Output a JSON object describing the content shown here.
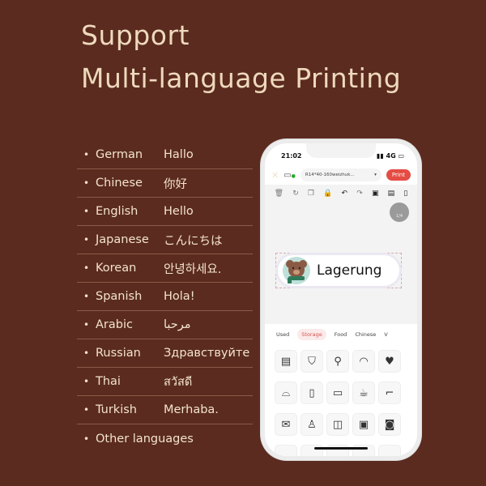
{
  "heading": {
    "line1": "Support",
    "line2": "Multi-language Printing"
  },
  "languages": [
    {
      "name": "German",
      "sample": "Hallo"
    },
    {
      "name": "Chinese",
      "sample": "你好"
    },
    {
      "name": "English",
      "sample": "Hello"
    },
    {
      "name": "Japanese",
      "sample": "こんにちは"
    },
    {
      "name": "Korean",
      "sample": "안녕하세요."
    },
    {
      "name": "Spanish",
      "sample": "Hola!"
    },
    {
      "name": "Arabic",
      "sample": "مرحبا"
    },
    {
      "name": "Russian",
      "sample": "Здравствуйте"
    },
    {
      "name": "Thai",
      "sample": "สวัสดี"
    },
    {
      "name": "Turkish",
      "sample": "Merhaba."
    },
    {
      "name": "Other languages",
      "sample": ""
    }
  ],
  "phone": {
    "time": "21:02",
    "signal": "4G",
    "template": "R14*40-160weizhuk...",
    "print_label": "Print",
    "page_indicator": "1/4",
    "label_text": "Lagerung",
    "tabs": [
      "Used",
      "Storage",
      "Food",
      "Chinese",
      "V"
    ],
    "active_tab": "Storage",
    "accent": "#e44c44",
    "icons": [
      "box",
      "backpack",
      "desk-lamp",
      "cap",
      "t-shirt",
      "hat",
      "fridge",
      "toilet-paper",
      "toothbrush-cup",
      "boot",
      "bag",
      "dress",
      "wardrobe",
      "microwave",
      "washing-machine"
    ]
  }
}
